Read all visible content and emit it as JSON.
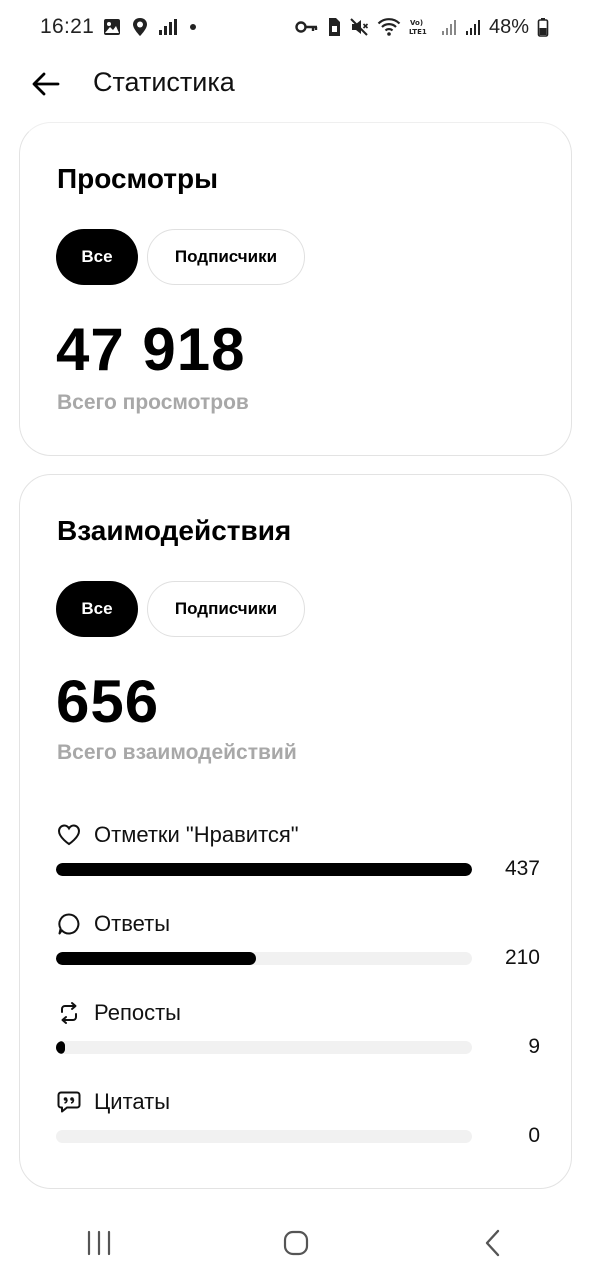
{
  "status_bar": {
    "time": "16:21",
    "battery_percent": "48%",
    "left_icons": [
      "gallery-icon",
      "location-icon",
      "signal-small-icon",
      "dot-icon"
    ],
    "right_icons": [
      "key-icon",
      "sim-icon",
      "mute-icon",
      "wifi-icon",
      "volte-icon",
      "signal-icon",
      "signal-icon",
      "battery-icon"
    ],
    "volte_text": "Vo)\nLTE1"
  },
  "app_bar": {
    "title": "Статистика",
    "back_icon": "arrow-left-icon"
  },
  "views_card": {
    "title": "Просмотры",
    "chips": [
      "Все",
      "Подписчики"
    ],
    "selected_chip": "Все",
    "total": "47 918",
    "subtitle": "Всего просмотров"
  },
  "interactions_card": {
    "title": "Взаимодействия",
    "chips": [
      "Все",
      "Подписчики"
    ],
    "selected_chip": "Все",
    "total": "656",
    "subtitle": "Всего взаимодействий",
    "metrics": [
      {
        "icon": "heart-icon",
        "label": "Отметки \"Нравится\"",
        "value": "437",
        "fraction": 1.0
      },
      {
        "icon": "reply-bubble-icon",
        "label": "Ответы",
        "value": "210",
        "fraction": 0.48
      },
      {
        "icon": "repost-icon",
        "label": "Репосты",
        "value": "9",
        "fraction": 0.02
      },
      {
        "icon": "quote-bubble-icon",
        "label": "Цитаты",
        "value": "0",
        "fraction": 0.0
      }
    ]
  },
  "nav_bar": {
    "buttons": [
      "recent-apps-icon",
      "home-icon",
      "back-icon"
    ]
  },
  "colors": {
    "accent": "#000000",
    "muted_text": "#a8a8a8",
    "track": "#f1f1f1",
    "card_border": "#e3e3e3"
  }
}
